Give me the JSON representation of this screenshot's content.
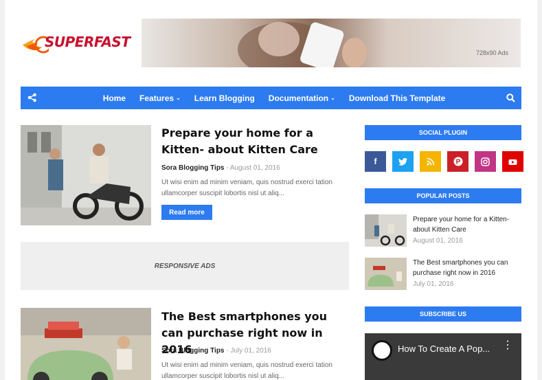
{
  "header": {
    "logo_text": "SUPERFAST",
    "ad_label": "728x90 Ads"
  },
  "nav": {
    "items": [
      {
        "label": "Home",
        "dropdown": false
      },
      {
        "label": "Features",
        "dropdown": true
      },
      {
        "label": "Learn Blogging",
        "dropdown": false
      },
      {
        "label": "Documentation",
        "dropdown": true
      },
      {
        "label": "Download This Template",
        "dropdown": false
      }
    ],
    "share_icon": "share-icon",
    "search_icon": "search-icon",
    "color": "#2d7bf0"
  },
  "posts": [
    {
      "title": "Prepare your home for a Kitten- about Kitten Care",
      "author": "Sora Blogging Tips",
      "date": "- August 01, 2016",
      "excerpt": "Ut wisi enim ad minim veniam, quis nostrud exerci tation ullamcorper suscipit lobortis nisl ut aliq...",
      "read_more": "Read more"
    },
    {
      "title": "The Best smartphones you can purchase right now in 2016",
      "author": "Sora Blogging Tips",
      "date": "- July 01, 2016",
      "excerpt": "Ut wisi enim ad minim veniam, quis nostrud exerci tation ullamcorper suscipit lobortis nisl ut aliq..."
    }
  ],
  "responsive_ads": "RESPONSIVE ADS",
  "sidebar": {
    "social_title": "SOCIAL PLUGIN",
    "social": [
      {
        "icon": "facebook-icon",
        "glyph": "f",
        "color": "#3b5998"
      },
      {
        "icon": "twitter-icon",
        "glyph": "t",
        "color": "#1da1f2"
      },
      {
        "icon": "rss-icon",
        "glyph": "rss",
        "color": "#f4b400"
      },
      {
        "icon": "pinterest-icon",
        "glyph": "P",
        "color": "#cb2027"
      },
      {
        "icon": "instagram-icon",
        "glyph": "◎",
        "color": "#c13584"
      },
      {
        "icon": "youtube-icon",
        "glyph": "▶",
        "color": "#e00000"
      }
    ],
    "popular_title": "POPULAR POSTS",
    "popular": [
      {
        "title": "Prepare your home for a Kitten- about Kitten Care",
        "date": "August 01, 2016"
      },
      {
        "title": "The Best smartphones you can purchase right now in 2016",
        "date": "July 01, 2016"
      }
    ],
    "subscribe_title": "SUBSCRIBE US",
    "video_title": "How To Create A Pop..."
  }
}
